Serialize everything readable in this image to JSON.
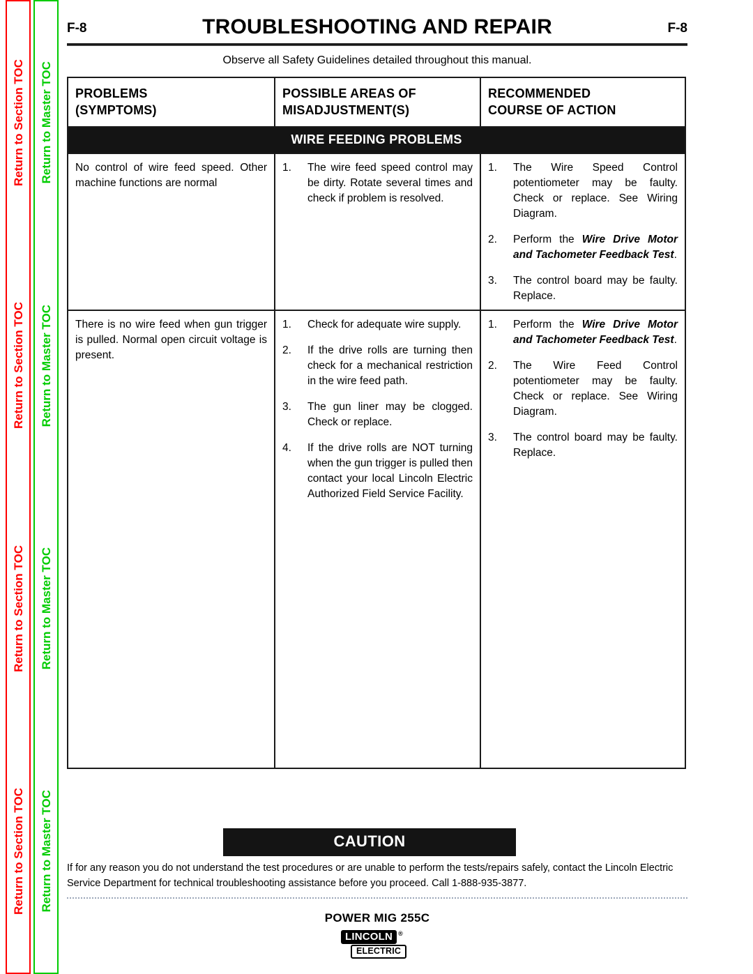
{
  "sidebars": {
    "section_toc": {
      "label": "Return to Section TOC",
      "color": "#ff0000",
      "repeat": 4
    },
    "master_toc": {
      "label": "Return to Master TOC",
      "color": "#00cc00",
      "repeat": 4
    }
  },
  "header": {
    "page_left": "F-8",
    "title": "TROUBLESHOOTING AND REPAIR",
    "page_right": "F-8"
  },
  "subtitle": "Observe all Safety Guidelines detailed throughout this manual.",
  "table": {
    "headers": {
      "col1_line1": "PROBLEMS",
      "col1_line2": "(SYMPTOMS)",
      "col2_line1": "POSSIBLE AREAS OF",
      "col2_line2": "MISADJUSTMENT(S)",
      "col3_line1": "RECOMMENDED",
      "col3_line2": "COURSE  OF  ACTION"
    },
    "banner": "WIRE FEEDING PROBLEMS",
    "rows": [
      {
        "symptom": "No control of wire feed speed. Other machine functions are normal",
        "possible_areas": [
          {
            "num": "1.",
            "text": "The wire feed speed control may be dirty. Rotate several times and check if problem is resolved."
          }
        ],
        "recommended": [
          {
            "num": "1.",
            "text": "The Wire Speed Control potentiometer may be faulty. Check or replace. See Wiring Diagram."
          },
          {
            "num": "2.",
            "pre": "Perform the ",
            "bold": "Wire Drive Motor and Tachometer Feedback Test",
            "post": "."
          },
          {
            "num": "3.",
            "text": "The control board may be faulty. Replace."
          }
        ]
      },
      {
        "symptom": "There is no wire feed when gun trigger is pulled. Normal open circuit voltage is present.",
        "possible_areas": [
          {
            "num": "1.",
            "text": "Check for adequate wire supply."
          },
          {
            "num": "2.",
            "text": "If the drive rolls are turning then check for a mechanical restriction in the wire feed path."
          },
          {
            "num": "3.",
            "text": "The gun liner may be clogged. Check or replace."
          },
          {
            "num": "4.",
            "text": "If the drive rolls are NOT turning when the gun trigger is pulled then contact your local Lincoln Electric Authorized Field Service Facility."
          }
        ],
        "recommended": [
          {
            "num": "1.",
            "pre": "Perform the ",
            "bold": "Wire Drive Motor and Tachometer Feedback Test",
            "post": "."
          },
          {
            "num": "2.",
            "text": "The Wire Feed Control potentiometer may be faulty. Check or replace. See Wiring Diagram."
          },
          {
            "num": "3.",
            "text": "The control board may be faulty. Replace."
          }
        ]
      }
    ]
  },
  "caution": {
    "title": "CAUTION",
    "text": "If for any reason you do not understand the test procedures or are unable to perform the tests/repairs safely, contact the Lincoln Electric Service Department for technical troubleshooting assistance before you proceed. Call 1-888-935-3877."
  },
  "footer": {
    "model": "POWER MIG 255C",
    "logo_primary": "LINCOLN",
    "logo_registered": "®",
    "logo_secondary": "ELECTRIC"
  }
}
